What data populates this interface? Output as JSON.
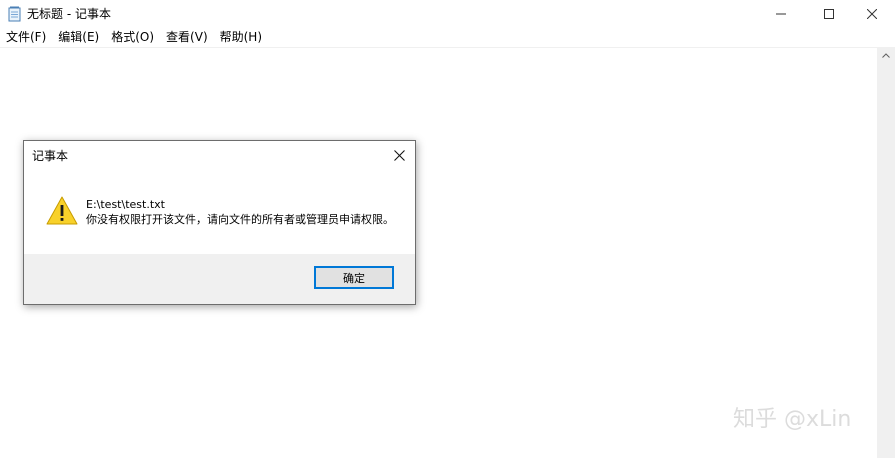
{
  "window": {
    "title": "无标题 - 记事本"
  },
  "menu": [
    {
      "label": "文件(F)"
    },
    {
      "label": "编辑(E)"
    },
    {
      "label": "格式(O)"
    },
    {
      "label": "查看(V)"
    },
    {
      "label": "帮助(H)"
    }
  ],
  "dialog": {
    "title": "记事本",
    "path": "E:\\test\\test.txt",
    "message": "你没有权限打开该文件，请向文件的所有者或管理员申请权限。",
    "ok_label": "确定",
    "icon": "warning-icon"
  },
  "watermark": "知乎 @xLin",
  "colors": {
    "accent": "#0078d7",
    "warning": "#f8d12a",
    "footer_bg": "#f0f0f0"
  }
}
